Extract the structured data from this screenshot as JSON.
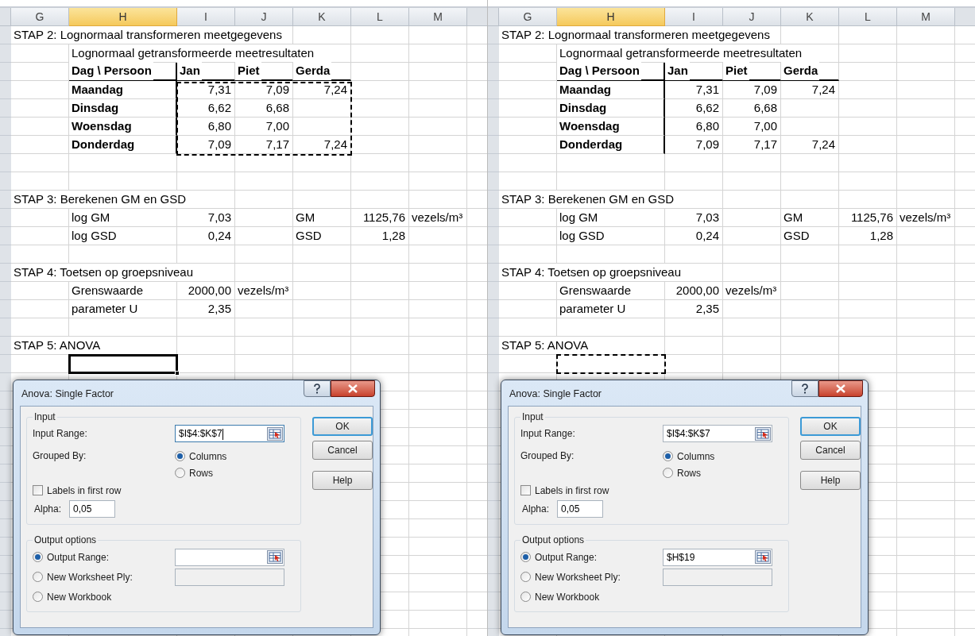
{
  "panels": [
    {
      "columns": [
        {
          "label": "G",
          "selected": false
        },
        {
          "label": "H",
          "selected": true
        },
        {
          "label": "I",
          "selected": false
        },
        {
          "label": "J",
          "selected": false
        },
        {
          "label": "K",
          "selected": false
        },
        {
          "label": "L",
          "selected": false
        },
        {
          "label": "M",
          "selected": false
        }
      ],
      "rows": [
        {
          "kind": "plain",
          "cells": [
            {
              "text": "STAP 2: Lognormaal transformeren meetgegevens"
            }
          ]
        },
        {
          "kind": "plain",
          "cells": [
            null,
            {
              "text": "Lognormaal getransformeerde meetresultaten"
            }
          ]
        },
        {
          "kind": "table_header",
          "cells": [
            null,
            {
              "text": "Dag \\ Persoon"
            },
            {
              "text": "Jan"
            },
            {
              "text": "Piet"
            },
            {
              "text": "Gerda"
            }
          ]
        },
        {
          "kind": "table_row",
          "marquee": true,
          "cells": [
            null,
            {
              "text": "Maandag"
            },
            {
              "text": "7,31",
              "kind": "number"
            },
            {
              "text": "7,09",
              "kind": "number"
            },
            {
              "text": "7,24",
              "kind": "number"
            }
          ]
        },
        {
          "kind": "table_row",
          "marquee": true,
          "cells": [
            null,
            {
              "text": "Dinsdag"
            },
            {
              "text": "6,62",
              "kind": "number"
            },
            {
              "text": "6,68",
              "kind": "number"
            }
          ]
        },
        {
          "kind": "table_row",
          "marquee": true,
          "cells": [
            null,
            {
              "text": "Woensdag"
            },
            {
              "text": "6,80",
              "kind": "number"
            },
            {
              "text": "7,00",
              "kind": "number"
            }
          ]
        },
        {
          "kind": "table_row",
          "marquee": true,
          "cells": [
            null,
            {
              "text": "Donderdag"
            },
            {
              "text": "7,09",
              "kind": "number"
            },
            {
              "text": "7,17",
              "kind": "number"
            },
            {
              "text": "7,24",
              "kind": "number"
            }
          ]
        },
        {
          "kind": "plain"
        },
        {
          "kind": "plain"
        },
        {
          "kind": "plain",
          "cells": [
            {
              "text": "STAP 3: Berekenen GM en GSD"
            }
          ]
        },
        {
          "kind": "plain",
          "cells": [
            null,
            {
              "text": "log GM"
            },
            {
              "text": "7,03",
              "kind": "number"
            },
            null,
            {
              "text": "GM"
            },
            {
              "text": "1125,76",
              "kind": "number"
            },
            {
              "text": "vezels/m³"
            }
          ]
        },
        {
          "kind": "plain",
          "cells": [
            null,
            {
              "text": "log GSD"
            },
            {
              "text": "0,24",
              "kind": "number"
            },
            null,
            {
              "text": "GSD"
            },
            {
              "text": "1,28",
              "kind": "number"
            }
          ]
        },
        {
          "kind": "plain"
        },
        {
          "kind": "plain",
          "cells": [
            {
              "text": "STAP 4: Toetsen op groepsniveau"
            }
          ]
        },
        {
          "kind": "plain",
          "cells": [
            null,
            {
              "text": "Grenswaarde"
            },
            {
              "text": "2000,00",
              "kind": "number"
            },
            {
              "text": "vezels/m³"
            }
          ]
        },
        {
          "kind": "plain",
          "cells": [
            null,
            {
              "text": "parameter U"
            },
            {
              "text": "2,35",
              "kind": "number"
            }
          ]
        },
        {
          "kind": "plain"
        },
        {
          "kind": "plain",
          "cells": [
            {
              "text": "STAP 5: ANOVA"
            }
          ]
        },
        {
          "kind": "plain",
          "cells": [
            null,
            {
              "kind": "active_cell"
            }
          ]
        }
      ],
      "dialog": {
        "title": "Anova: Single Factor",
        "input_group": {
          "label": "Input",
          "input_range": {
            "label": "Input Range:",
            "value": "$I$4:$K$7",
            "focused": true
          },
          "grouped_by": {
            "label": "Grouped By:",
            "options": [
              {
                "label": "Columns",
                "selected": true
              },
              {
                "label": "Rows",
                "selected": false
              }
            ]
          },
          "labels_in_first_row": {
            "label": "Labels in first row",
            "checked": false
          },
          "alpha": {
            "label": "Alpha:",
            "value": "0,05"
          }
        },
        "output_group": {
          "label": "Output options",
          "options": [
            {
              "label": "Output Range:",
              "selected": true,
              "field": {
                "disabled": false
              }
            },
            {
              "label": "New Worksheet Ply:",
              "selected": false,
              "field": {
                "disabled": true
              }
            },
            {
              "label": "New Workbook",
              "selected": false
            }
          ]
        },
        "buttons": [
          {
            "label": "OK",
            "default": true
          },
          {
            "label": "Cancel",
            "default": false
          },
          {
            "label": "Help",
            "default": false
          }
        ]
      }
    },
    {
      "columns": [
        {
          "label": "G",
          "selected": false
        },
        {
          "label": "H",
          "selected": true
        },
        {
          "label": "I",
          "selected": false
        },
        {
          "label": "J",
          "selected": false
        },
        {
          "label": "K",
          "selected": false
        },
        {
          "label": "L",
          "selected": false
        },
        {
          "label": "M",
          "selected": false
        }
      ],
      "rows": [
        {
          "kind": "plain",
          "cells": [
            {
              "text": "STAP 2: Lognormaal transformeren meetgegevens"
            }
          ]
        },
        {
          "kind": "plain",
          "cells": [
            null,
            {
              "text": "Lognormaal getransformeerde meetresultaten"
            }
          ]
        },
        {
          "kind": "table_header",
          "cells": [
            null,
            {
              "text": "Dag \\ Persoon"
            },
            {
              "text": "Jan"
            },
            {
              "text": "Piet"
            },
            {
              "text": "Gerda"
            }
          ]
        },
        {
          "kind": "table_row",
          "marquee": false,
          "cells": [
            null,
            {
              "text": "Maandag"
            },
            {
              "text": "7,31",
              "kind": "number"
            },
            {
              "text": "7,09",
              "kind": "number"
            },
            {
              "text": "7,24",
              "kind": "number"
            }
          ]
        },
        {
          "kind": "table_row",
          "marquee": false,
          "cells": [
            null,
            {
              "text": "Dinsdag"
            },
            {
              "text": "6,62",
              "kind": "number"
            },
            {
              "text": "6,68",
              "kind": "number"
            }
          ]
        },
        {
          "kind": "table_row",
          "marquee": false,
          "cells": [
            null,
            {
              "text": "Woensdag"
            },
            {
              "text": "6,80",
              "kind": "number"
            },
            {
              "text": "7,00",
              "kind": "number"
            }
          ]
        },
        {
          "kind": "table_row",
          "marquee": false,
          "cells": [
            null,
            {
              "text": "Donderdag"
            },
            {
              "text": "7,09",
              "kind": "number"
            },
            {
              "text": "7,17",
              "kind": "number"
            },
            {
              "text": "7,24",
              "kind": "number"
            }
          ]
        },
        {
          "kind": "plain"
        },
        {
          "kind": "plain"
        },
        {
          "kind": "plain",
          "cells": [
            {
              "text": "STAP 3: Berekenen GM en GSD"
            }
          ]
        },
        {
          "kind": "plain",
          "cells": [
            null,
            {
              "text": "log GM"
            },
            {
              "text": "7,03",
              "kind": "number"
            },
            null,
            {
              "text": "GM"
            },
            {
              "text": "1125,76",
              "kind": "number"
            },
            {
              "text": "vezels/m³"
            }
          ]
        },
        {
          "kind": "plain",
          "cells": [
            null,
            {
              "text": "log GSD"
            },
            {
              "text": "0,24",
              "kind": "number"
            },
            null,
            {
              "text": "GSD"
            },
            {
              "text": "1,28",
              "kind": "number"
            }
          ]
        },
        {
          "kind": "plain"
        },
        {
          "kind": "plain",
          "cells": [
            {
              "text": "STAP 4: Toetsen op groepsniveau"
            }
          ]
        },
        {
          "kind": "plain",
          "cells": [
            null,
            {
              "text": "Grenswaarde"
            },
            {
              "text": "2000,00",
              "kind": "number"
            },
            {
              "text": "vezels/m³"
            }
          ]
        },
        {
          "kind": "plain",
          "cells": [
            null,
            {
              "text": "parameter U"
            },
            {
              "text": "2,35",
              "kind": "number"
            }
          ]
        },
        {
          "kind": "plain"
        },
        {
          "kind": "plain",
          "cells": [
            {
              "text": "STAP 5: ANOVA"
            }
          ]
        },
        {
          "kind": "plain",
          "cells": [
            null,
            {
              "kind": "copy_target"
            }
          ]
        }
      ],
      "dialog": {
        "title": "Anova: Single Factor",
        "input_group": {
          "label": "Input",
          "input_range": {
            "label": "Input Range:",
            "value": "$I$4:$K$7",
            "focused": false
          },
          "grouped_by": {
            "label": "Grouped By:",
            "options": [
              {
                "label": "Columns",
                "selected": true
              },
              {
                "label": "Rows",
                "selected": false
              }
            ]
          },
          "labels_in_first_row": {
            "label": "Labels in first row",
            "checked": false
          },
          "alpha": {
            "label": "Alpha:",
            "value": "0,05"
          }
        },
        "output_group": {
          "label": "Output options",
          "options": [
            {
              "label": "Output Range:",
              "selected": true,
              "field": {
                "value": "$H$19",
                "disabled": false
              }
            },
            {
              "label": "New Worksheet Ply:",
              "selected": false,
              "field": {
                "disabled": true
              }
            },
            {
              "label": "New Workbook",
              "selected": false
            }
          ]
        },
        "buttons": [
          {
            "label": "OK",
            "default": true
          },
          {
            "label": "Cancel",
            "default": false
          },
          {
            "label": "Help",
            "default": false
          }
        ]
      }
    }
  ]
}
